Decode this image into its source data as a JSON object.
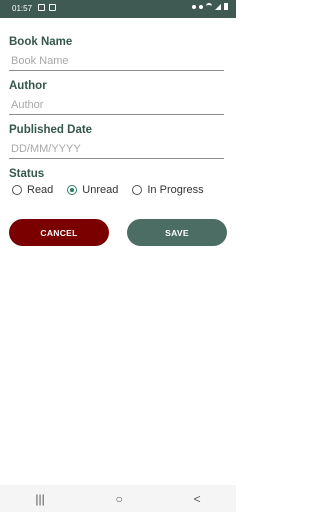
{
  "statusbar": {
    "time": "01:57"
  },
  "form": {
    "book_name": {
      "label": "Book Name",
      "placeholder": "Book Name",
      "value": ""
    },
    "author": {
      "label": "Author",
      "placeholder": "Author",
      "value": ""
    },
    "published_date": {
      "label": "Published Date",
      "placeholder": "DD/MM/YYYY",
      "value": ""
    },
    "status": {
      "label": "Status",
      "options": [
        "Read",
        "Unread",
        "In Progress"
      ],
      "selected": "Unread"
    }
  },
  "buttons": {
    "cancel": "CANCEL",
    "save": "SAVE"
  },
  "navbar": {
    "recents_icon": "|||",
    "home_icon": "○",
    "back_icon": "<"
  },
  "colors": {
    "accent": "#36574d",
    "cancel": "#7a0000",
    "save": "#4c6d64",
    "radio": "#2a7f68"
  }
}
